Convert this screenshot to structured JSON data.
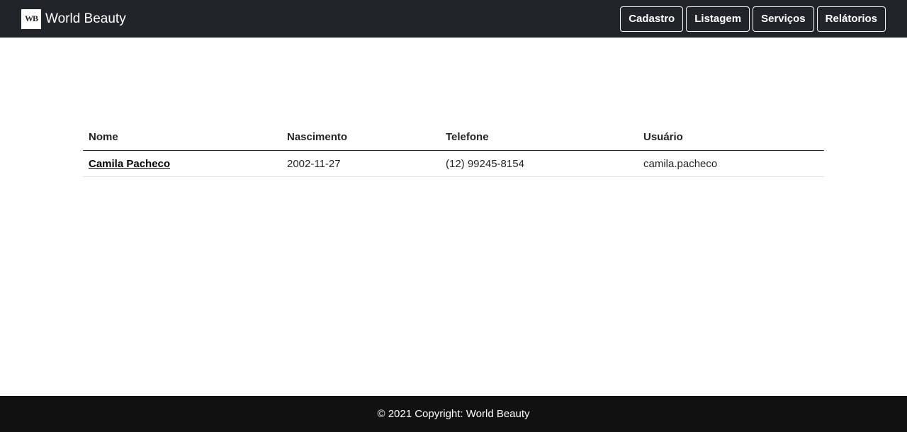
{
  "navbar": {
    "logo_text": "WB",
    "brand_name": "World Beauty",
    "buttons": [
      "Cadastro",
      "Listagem",
      "Serviços",
      "Relátorios"
    ]
  },
  "table": {
    "headers": [
      "Nome",
      "Nascimento",
      "Telefone",
      "Usuário"
    ],
    "rows": [
      {
        "nome": "Camila Pacheco",
        "nascimento": "2002-11-27",
        "telefone": "(12) 99245-8154",
        "usuario": "camila.pacheco"
      }
    ]
  },
  "footer": {
    "text": "© 2021 Copyright: World Beauty"
  },
  "colors": {
    "navbar_bg": "#212529",
    "footer_bg": "#111111",
    "text": "#212529"
  }
}
